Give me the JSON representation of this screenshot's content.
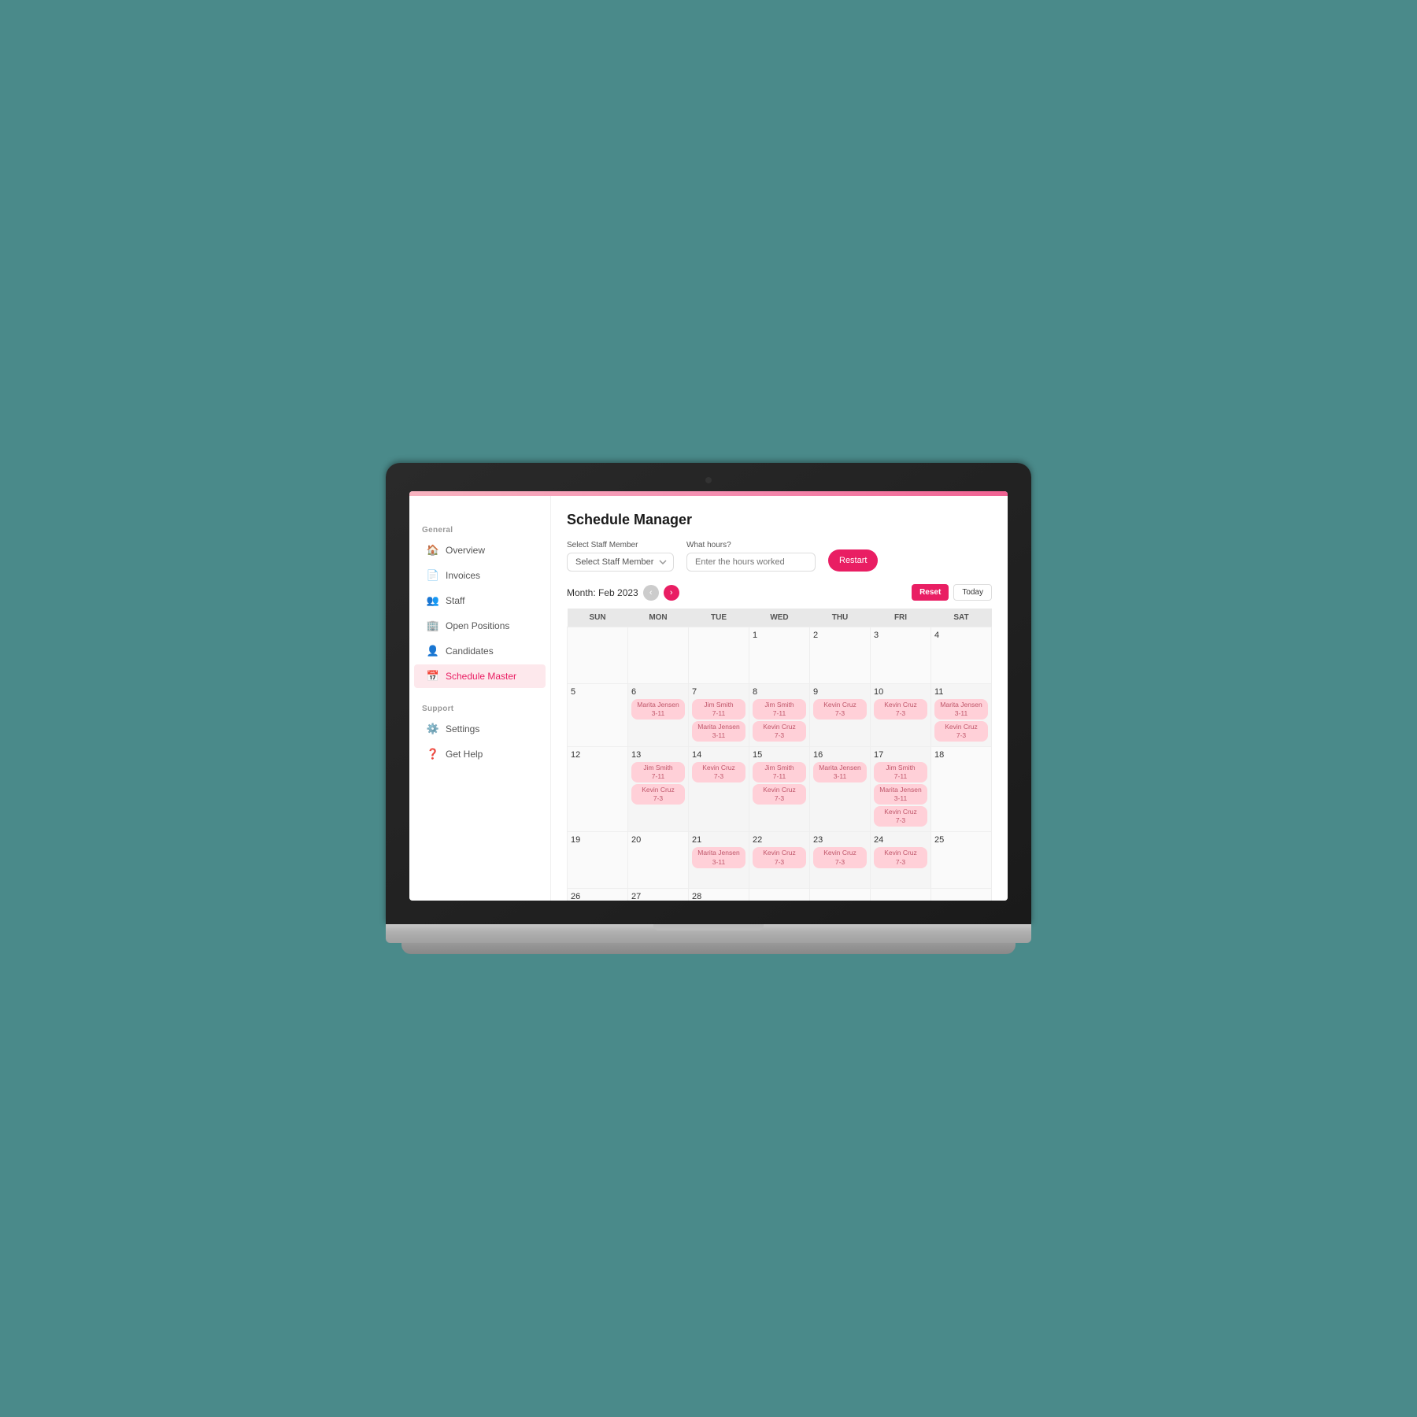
{
  "page": {
    "title": "Schedule Manager",
    "month_label": "Month: Feb 2023"
  },
  "sidebar": {
    "general_label": "General",
    "support_label": "Support",
    "items": [
      {
        "id": "overview",
        "label": "Overview",
        "icon": "🏠",
        "active": false
      },
      {
        "id": "invoices",
        "label": "Invoices",
        "icon": "📄",
        "active": false
      },
      {
        "id": "staff",
        "label": "Staff",
        "icon": "👥",
        "active": false
      },
      {
        "id": "open-positions",
        "label": "Open Positions",
        "icon": "🏢",
        "active": false
      },
      {
        "id": "candidates",
        "label": "Candidates",
        "icon": "👤",
        "active": false
      },
      {
        "id": "schedule-master",
        "label": "Schedule Master",
        "icon": "📅",
        "active": true
      }
    ],
    "support_items": [
      {
        "id": "settings",
        "label": "Settings",
        "icon": "⚙️",
        "active": false
      },
      {
        "id": "get-help",
        "label": "Get Help",
        "icon": "❓",
        "active": false
      }
    ]
  },
  "toolbar": {
    "staff_label": "Select Staff Member",
    "staff_placeholder": "Select Staff Member",
    "hours_label": "What hours?",
    "hours_placeholder": "Enter the hours worked",
    "restart_label": "Restart",
    "reset_label": "Reset",
    "today_label": "Today"
  },
  "calendar": {
    "days": [
      "SUN",
      "MON",
      "TUE",
      "WED",
      "THU",
      "FRI",
      "SAT"
    ],
    "weeks": [
      [
        {
          "day": "",
          "shifts": []
        },
        {
          "day": "",
          "shifts": []
        },
        {
          "day": "",
          "shifts": []
        },
        {
          "day": "1",
          "shifts": []
        },
        {
          "day": "2",
          "shifts": []
        },
        {
          "day": "3",
          "shifts": []
        },
        {
          "day": "4",
          "shifts": []
        }
      ],
      [
        {
          "day": "5",
          "shifts": []
        },
        {
          "day": "6",
          "shifts": [
            {
              "name": "Marita Jensen",
              "hours": "3-11"
            }
          ]
        },
        {
          "day": "7",
          "shifts": [
            {
              "name": "Jim Smith",
              "hours": "7-11"
            },
            {
              "name": "Marita Jensen",
              "hours": "3-11"
            }
          ]
        },
        {
          "day": "8",
          "shifts": [
            {
              "name": "Jim Smith",
              "hours": "7-11"
            },
            {
              "name": "Kevin Cruz",
              "hours": "7-3"
            }
          ]
        },
        {
          "day": "9",
          "shifts": [
            {
              "name": "Kevin Cruz",
              "hours": "7-3"
            }
          ]
        },
        {
          "day": "10",
          "shifts": [
            {
              "name": "Kevin Cruz",
              "hours": "7-3"
            }
          ]
        },
        {
          "day": "11",
          "shifts": [
            {
              "name": "Marita Jensen",
              "hours": "3-11"
            },
            {
              "name": "Kevin Cruz",
              "hours": "7-3"
            }
          ]
        }
      ],
      [
        {
          "day": "12",
          "shifts": []
        },
        {
          "day": "13",
          "shifts": [
            {
              "name": "Jim Smith",
              "hours": "7-11"
            },
            {
              "name": "Kevin Cruz",
              "hours": "7-3"
            }
          ]
        },
        {
          "day": "14",
          "shifts": [
            {
              "name": "Kevin Cruz",
              "hours": "7-3"
            }
          ]
        },
        {
          "day": "15",
          "shifts": [
            {
              "name": "Jim Smith",
              "hours": "7-11"
            },
            {
              "name": "Kevin Cruz",
              "hours": "7-3"
            }
          ]
        },
        {
          "day": "16",
          "shifts": [
            {
              "name": "Marita Jensen",
              "hours": "3-11"
            }
          ]
        },
        {
          "day": "17",
          "shifts": [
            {
              "name": "Jim Smith",
              "hours": "7-11"
            },
            {
              "name": "Marita Jensen",
              "hours": "3-11"
            },
            {
              "name": "Kevin Cruz",
              "hours": "7-3"
            }
          ]
        },
        {
          "day": "18",
          "shifts": []
        }
      ],
      [
        {
          "day": "19",
          "shifts": []
        },
        {
          "day": "20",
          "shifts": []
        },
        {
          "day": "21",
          "shifts": [
            {
              "name": "Marita Jensen",
              "hours": "3-11"
            }
          ]
        },
        {
          "day": "22",
          "shifts": [
            {
              "name": "Kevin Cruz",
              "hours": "7-3"
            }
          ]
        },
        {
          "day": "23",
          "shifts": [
            {
              "name": "Kevin Cruz",
              "hours": "7-3"
            }
          ]
        },
        {
          "day": "24",
          "shifts": [
            {
              "name": "Kevin Cruz",
              "hours": "7-3"
            }
          ]
        },
        {
          "day": "25",
          "shifts": []
        }
      ],
      [
        {
          "day": "26",
          "shifts": []
        },
        {
          "day": "27",
          "shifts": []
        },
        {
          "day": "28",
          "shifts": []
        },
        {
          "day": "",
          "shifts": []
        },
        {
          "day": "",
          "shifts": []
        },
        {
          "day": "",
          "shifts": []
        },
        {
          "day": "",
          "shifts": []
        }
      ]
    ]
  }
}
